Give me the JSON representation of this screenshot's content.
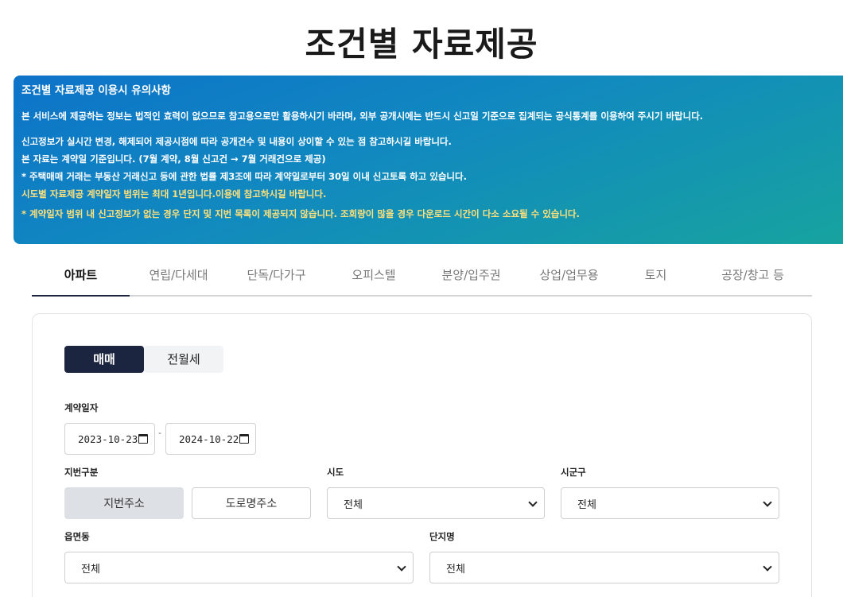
{
  "page": {
    "title": "조건별 자료제공"
  },
  "notice": {
    "title": "조건별 자료제공 이용시 유의사항",
    "line1": "본 서비스에 제공하는 정보는 법적인 효력이 없으므로 참고용으로만 활용하시기 바라며, 외부 공개시에는 반드시 신고일 기준으로 집계되는 공식통계를 이용하여 주시기 바랍니다.",
    "line2": "신고정보가 실시간 변경, 해제되어 제공시점에 따라 공개건수 및 내용이 상이할 수 있는 점 참고하시길 바랍니다.",
    "line3": "본 자료는 계약일 기준입니다. (7월 계약, 8월 신고건 → 7월 거래건으로 제공)",
    "line4": "* 주택매매 거래는 부동산 거래신고 등에 관한 법률 제3조에 따라 계약일로부터 30일 이내 신고토록 하고 있습니다.",
    "line5": "시도별 자료제공 계약일자 범위는 최대 1년입니다.이용에 참고하시길 바랍니다.",
    "line6": "* 계약일자 범위 내 신고정보가 없는 경우 단지 및 지번 목록이 제공되지 않습니다. 조회량이 많을 경우 다운로드 시간이 다소 소요될 수 있습니다.",
    "highlight_color": "#ffe07a"
  },
  "tabs": [
    "아파트",
    "연립/다세대",
    "단독/다가구",
    "오피스텔",
    "분양/입주권",
    "상업/업무용",
    "토지",
    "공장/창고 등"
  ],
  "active_tab": "아파트",
  "deal_type": {
    "sale": "매매",
    "lease": "전월세",
    "selected": "매매"
  },
  "form": {
    "contract_date_label": "계약일자",
    "date_from": "2023-10-23",
    "date_to": "2024-10-22",
    "date_separator": "-",
    "lot_type_label": "지번구분",
    "lot_type_jibun": "지번주소",
    "lot_type_road": "도로명주소",
    "sido_label": "시도",
    "sido_value": "전체",
    "sigungu_label": "시군구",
    "sigungu_value": "전체",
    "eupmyeondong_label": "읍면동",
    "eupmyeondong_value": "전체",
    "complex_label": "단지명",
    "complex_value": "전체"
  },
  "colors": {
    "accent": "#1c2540",
    "banner_start": "#0d73c9",
    "banner_end": "#17a39f"
  }
}
